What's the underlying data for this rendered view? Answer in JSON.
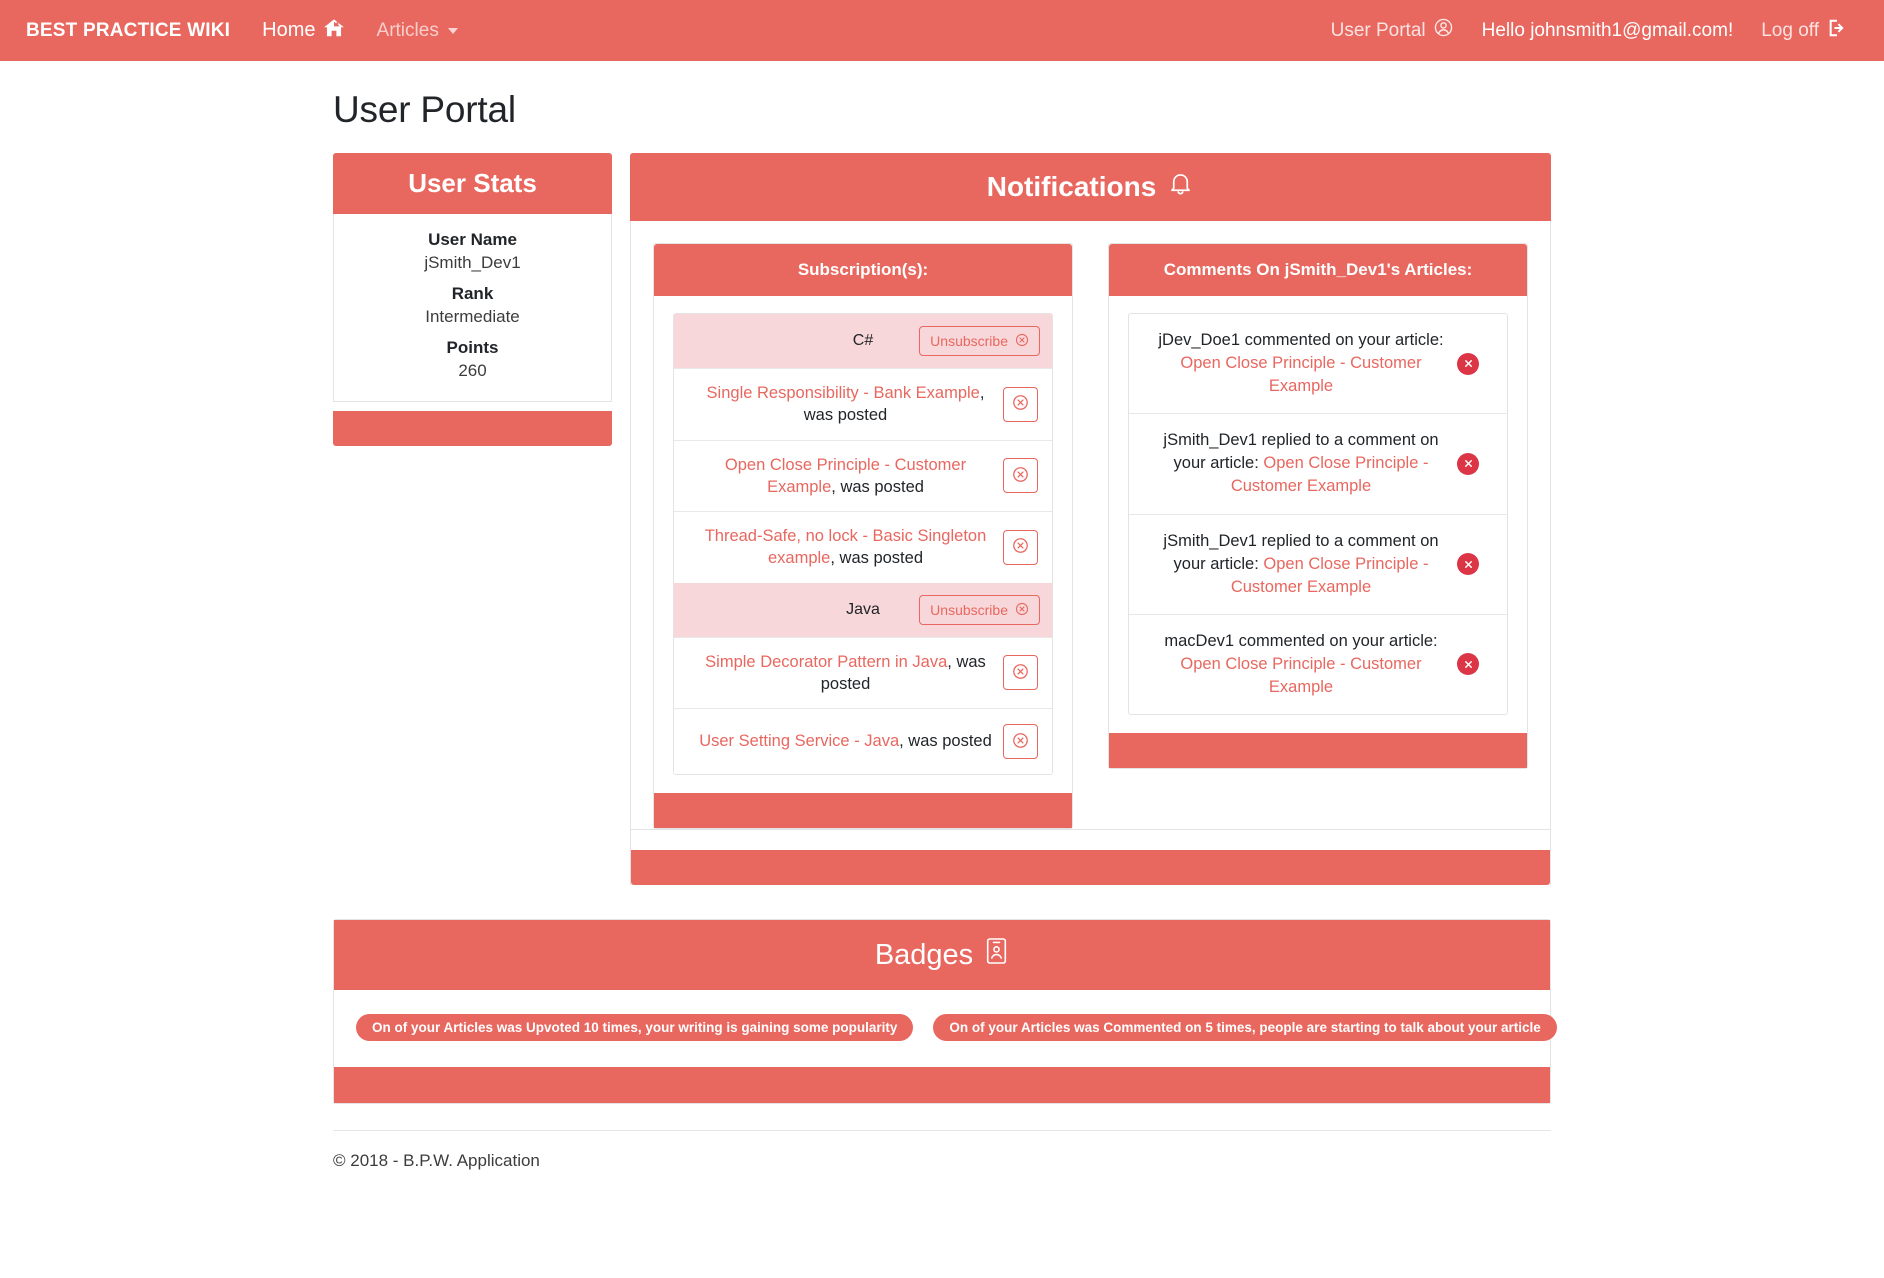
{
  "navbar": {
    "brand": "BEST PRACTICE WIKI",
    "home_label": "Home",
    "home_icon": "home-icon",
    "articles_label": "Articles",
    "articles_caret_icon": "chevron-down-icon",
    "user_portal_label": "User Portal",
    "user_portal_icon": "user-circle-icon",
    "greeting": "Hello johnsmith1@gmail.com!",
    "logoff_label": "Log off",
    "logoff_icon": "sign-out-icon"
  },
  "page": {
    "title": "User Portal"
  },
  "user_stats": {
    "header": "User Stats",
    "fields": [
      {
        "label": "User Name",
        "value": "jSmith_Dev1"
      },
      {
        "label": "Rank",
        "value": "Intermediate"
      },
      {
        "label": "Points",
        "value": "260"
      }
    ]
  },
  "notifications": {
    "header": "Notifications",
    "header_icon": "bell-icon",
    "subscriptions": {
      "header": "Subscription(s):",
      "unsubscribe_label": "Unsubscribe",
      "unsubscribe_icon": "circle-x-icon",
      "dismiss_icon": "circle-x-icon",
      "groups": [
        {
          "name": "C#",
          "items": [
            {
              "link": "Single Responsibility - Bank Example",
              "suffix": ", was posted"
            },
            {
              "link": "Open Close Principle - Customer Example",
              "suffix": ", was posted"
            },
            {
              "link": "Thread-Safe, no lock - Basic Singleton example",
              "suffix": ", was posted"
            }
          ]
        },
        {
          "name": "Java",
          "items": [
            {
              "link": "Simple Decorator Pattern in Java",
              "suffix": ", was posted"
            },
            {
              "link": "User Setting Service - Java",
              "suffix": ", was posted"
            }
          ]
        }
      ]
    },
    "comments": {
      "header": "Comments On jSmith_Dev1's Articles:",
      "dismiss_icon": "circle-x-icon",
      "items": [
        {
          "prefix": "jDev_Doe1 commented on your article: ",
          "link": "Open Close Principle - Customer Example"
        },
        {
          "prefix": "jSmith_Dev1 replied to a comment on your article: ",
          "link": "Open Close Principle - Customer Example"
        },
        {
          "prefix": "jSmith_Dev1 replied to a comment on your article: ",
          "link": "Open Close Principle - Customer Example"
        },
        {
          "prefix": "macDev1 commented on your article: ",
          "link": "Open Close Principle - Customer Example"
        }
      ]
    }
  },
  "badges": {
    "header": "Badges",
    "header_icon": "id-card-icon",
    "items": [
      "On of your Articles was Upvoted 10 times, your writing is gaining some popularity",
      "On of your Articles was Commented on 5 times, people are starting to talk about your article"
    ]
  },
  "footer": {
    "copyright": "© 2018 - B.P.W. Application"
  },
  "colors": {
    "accent": "#E8675F",
    "accent_light": "#F8D7DA",
    "danger": "#dc3545"
  }
}
